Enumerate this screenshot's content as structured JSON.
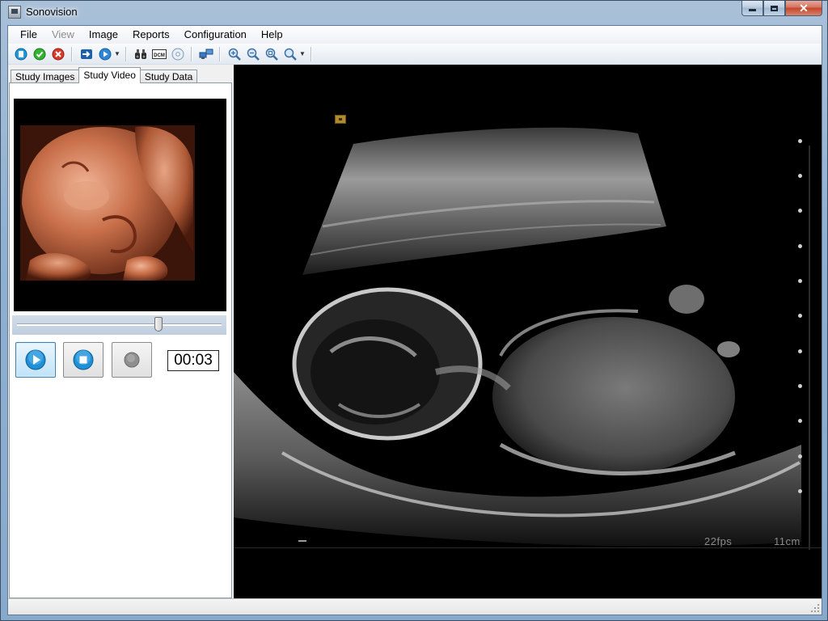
{
  "window": {
    "title": "Sonovision"
  },
  "menu": {
    "items": [
      {
        "label": "File",
        "enabled": true
      },
      {
        "label": "View",
        "enabled": false
      },
      {
        "label": "Image",
        "enabled": true
      },
      {
        "label": "Reports",
        "enabled": true
      },
      {
        "label": "Configuration",
        "enabled": true
      },
      {
        "label": "Help",
        "enabled": true
      }
    ]
  },
  "toolbar": {
    "buttons": [
      {
        "icon": "new-study-icon"
      },
      {
        "icon": "accept-icon"
      },
      {
        "icon": "cancel-icon"
      },
      {
        "icon": "export-arrow-icon"
      },
      {
        "icon": "play-options-icon"
      },
      {
        "icon": "binoculars-icon"
      },
      {
        "icon": "dicom-icon",
        "text": "DCM"
      },
      {
        "icon": "disc-icon"
      },
      {
        "icon": "network-icon"
      },
      {
        "icon": "zoom-in-icon"
      },
      {
        "icon": "zoom-out-icon"
      },
      {
        "icon": "zoom-fit-icon"
      },
      {
        "icon": "zoom-options-icon"
      }
    ]
  },
  "tabs": [
    {
      "label": "Study Images",
      "active": false
    },
    {
      "label": "Study Video",
      "active": true
    },
    {
      "label": "Study Data",
      "active": false
    }
  ],
  "player": {
    "position": 0.69,
    "time": "00:03"
  },
  "video": {
    "fps_label": "22fps",
    "depth_label": "11cm"
  },
  "colors": {
    "accent": "#3c7fb1",
    "play_blue": "#1f8fd6",
    "close_red": "#c4452c"
  }
}
